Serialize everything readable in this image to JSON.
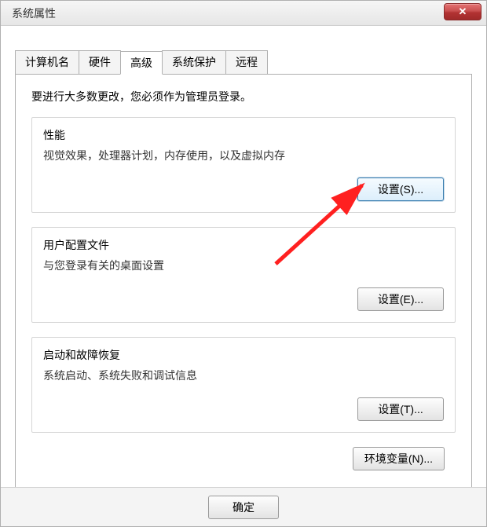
{
  "window": {
    "title": "系统属性"
  },
  "tabs": {
    "computer_name": "计算机名",
    "hardware": "硬件",
    "advanced": "高级",
    "system_protection": "系统保护",
    "remote": "远程"
  },
  "intro": "要进行大多数更改，您必须作为管理员登录。",
  "performance": {
    "title": "性能",
    "desc": "视觉效果，处理器计划，内存使用，以及虚拟内存",
    "button": "设置(S)..."
  },
  "user_profiles": {
    "title": "用户配置文件",
    "desc": "与您登录有关的桌面设置",
    "button": "设置(E)..."
  },
  "startup": {
    "title": "启动和故障恢复",
    "desc": "系统启动、系统失败和调试信息",
    "button": "设置(T)..."
  },
  "env_vars": {
    "button": "环境变量(N)..."
  },
  "footer": {
    "ok": "确定"
  }
}
